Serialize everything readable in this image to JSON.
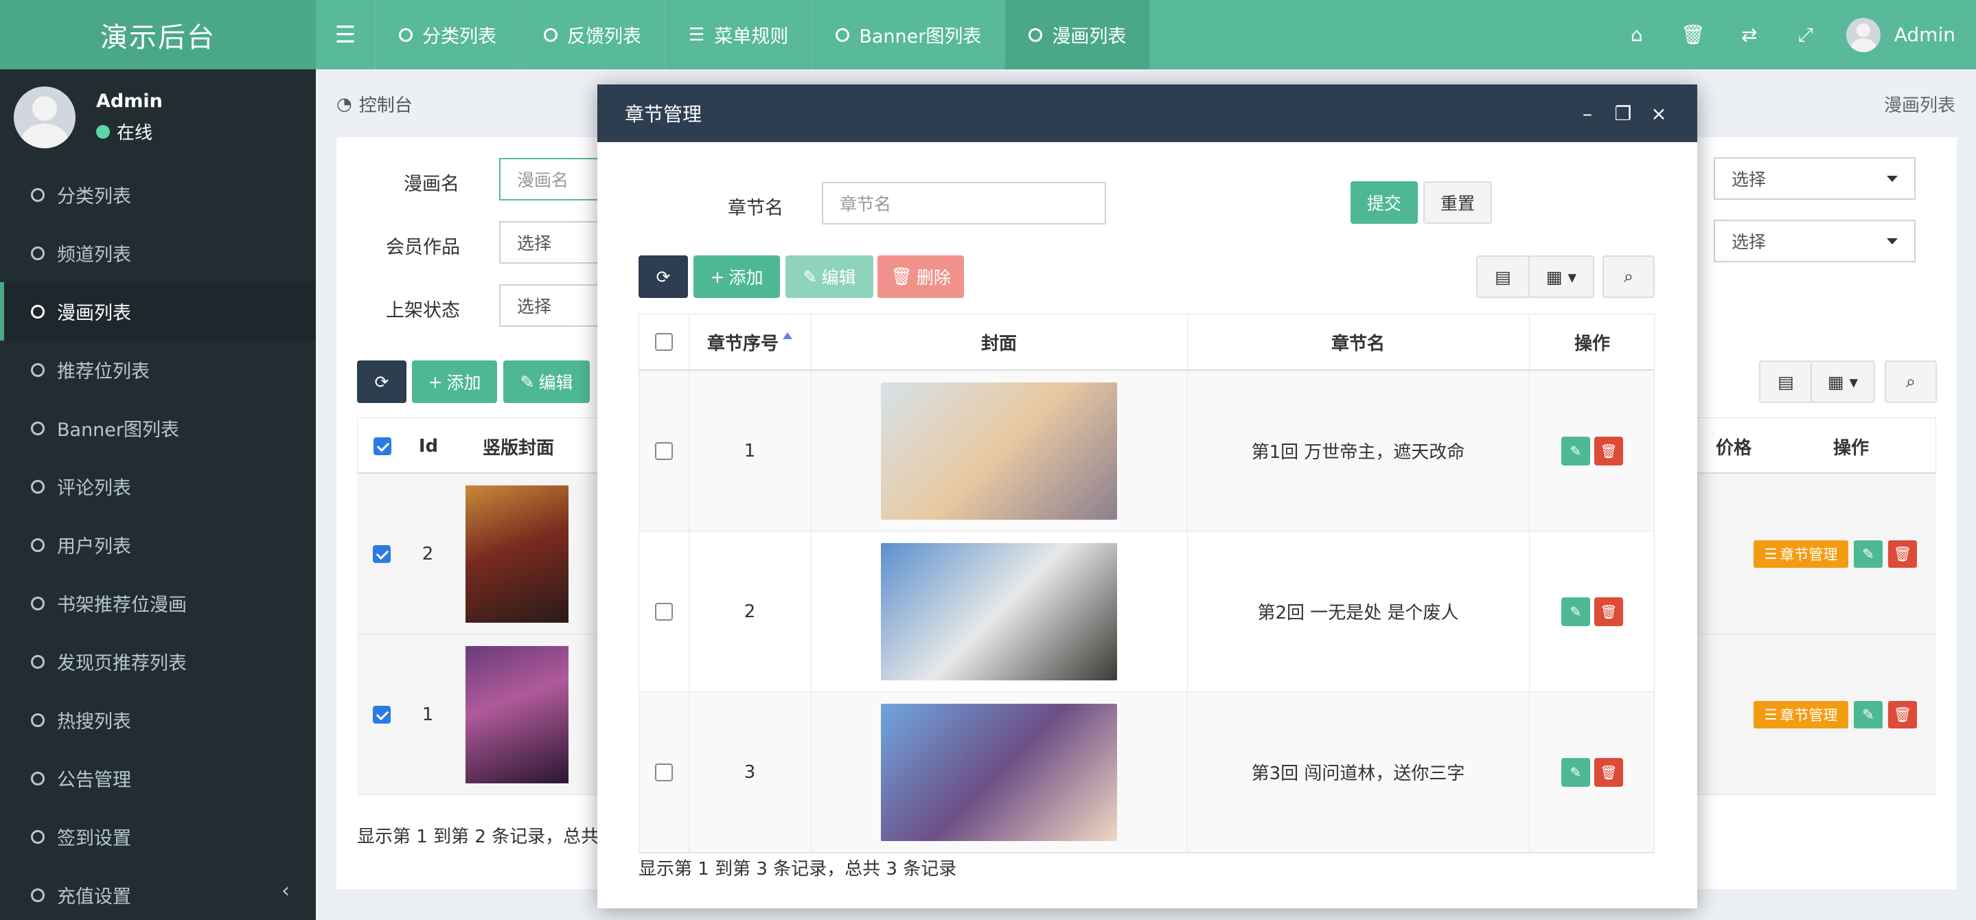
{
  "header": {
    "brand": "演示后台",
    "tabs": [
      {
        "label": "分类列表",
        "icon": "circle-icon"
      },
      {
        "label": "反馈列表",
        "icon": "circle-icon"
      },
      {
        "label": "菜单规则",
        "icon": "list-icon"
      },
      {
        "label": "Banner图列表",
        "icon": "circle-icon"
      },
      {
        "label": "漫画列表",
        "icon": "circle-icon"
      }
    ],
    "user": "Admin"
  },
  "sidebar": {
    "user_name": "Admin",
    "user_status": "在线",
    "items": [
      {
        "label": "分类列表"
      },
      {
        "label": "频道列表"
      },
      {
        "label": "漫画列表"
      },
      {
        "label": "推荐位列表"
      },
      {
        "label": "Banner图列表"
      },
      {
        "label": "评论列表"
      },
      {
        "label": "用户列表"
      },
      {
        "label": "书架推荐位漫画"
      },
      {
        "label": "发现页推荐列表"
      },
      {
        "label": "热搜列表"
      },
      {
        "label": "公告管理"
      },
      {
        "label": "签到设置"
      },
      {
        "label": "充值设置"
      }
    ],
    "active_index": 2
  },
  "content": {
    "breadcrumb": "控制台",
    "page_name": "漫画列表",
    "filters": {
      "comic_name_label": "漫画名",
      "comic_name_placeholder": "漫画名",
      "member_label": "会员作品",
      "member_value": "选择",
      "status_label": "上架状态",
      "status_value": "选择",
      "right_select_1": "选择",
      "right_select_2": "选择"
    },
    "toolbar": {
      "add": "添加",
      "edit": "编辑"
    },
    "table": {
      "headers": {
        "id": "Id",
        "cover": "竖版封面",
        "price_partial": "价格",
        "ops": "操作"
      },
      "rows": [
        {
          "id": "2",
          "chapter_btn": "章节管理"
        },
        {
          "id": "1",
          "chapter_btn": "章节管理"
        }
      ]
    },
    "footer": "显示第 1 到第 2 条记录，总共"
  },
  "modal": {
    "title": "章节管理",
    "filter_label": "章节名",
    "filter_placeholder": "章节名",
    "submit": "提交",
    "reset": "重置",
    "toolbar": {
      "add": "添加",
      "edit": "编辑",
      "delete": "删除"
    },
    "headers": {
      "seq": "章节序号",
      "cover": "封面",
      "name": "章节名",
      "ops": "操作"
    },
    "rows": [
      {
        "seq": "1",
        "name": "第1回 万世帝主，遮天改命",
        "cover_colors": [
          "#d7e1ea",
          "#e8c9a0",
          "#8c7f8e"
        ]
      },
      {
        "seq": "2",
        "name": "第2回 一无是处 是个废人",
        "cover_colors": [
          "#5b8fce",
          "#e8e8e8",
          "#3a3a36"
        ]
      },
      {
        "seq": "3",
        "name": "第3回 闯问道林，送你三字",
        "cover_colors": [
          "#6fa6df",
          "#6d4e86",
          "#f0d8c2"
        ]
      }
    ],
    "footer": "显示第 1 到第 3 条记录，总共 3 条记录"
  },
  "colors": {
    "primary": "#58b99b",
    "primary_dark": "#4aa887",
    "sidebar_bg": "#222d32",
    "dark_btn": "#2c3e50",
    "danger": "#dd4b39",
    "warning": "#f39c12"
  }
}
